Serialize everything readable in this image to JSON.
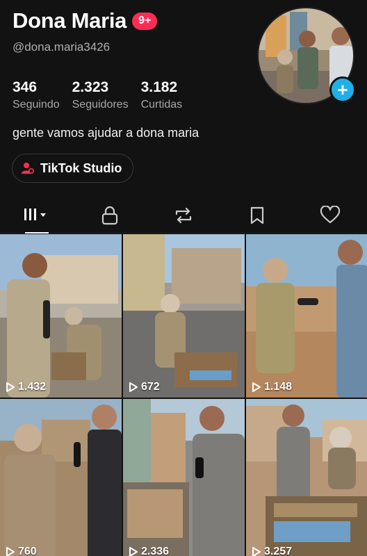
{
  "profile": {
    "name": "Dona Maria",
    "notif_badge": "9+",
    "handle": "@dona.maria3426",
    "bio": "gente vamos ajudar a dona maria"
  },
  "stats": [
    {
      "value": "346",
      "label": "Seguindo"
    },
    {
      "value": "2.323",
      "label": "Seguidores"
    },
    {
      "value": "3.182",
      "label": "Curtidas"
    }
  ],
  "studio_button": {
    "label": "TikTok Studio"
  },
  "tabs": [
    {
      "icon": "grid-icon",
      "active": true
    },
    {
      "icon": "lock-icon",
      "active": false
    },
    {
      "icon": "repost-icon",
      "active": false
    },
    {
      "icon": "bookmark-icon",
      "active": false
    },
    {
      "icon": "heart-icon",
      "active": false
    }
  ],
  "videos": [
    {
      "views": "1.432"
    },
    {
      "views": "672"
    },
    {
      "views": "1.148"
    },
    {
      "views": "760"
    },
    {
      "views": "2.336"
    },
    {
      "views": "3.257"
    }
  ],
  "colors": {
    "accent": "#fe2c55",
    "add_button": "#20b0e8",
    "background": "#121212"
  }
}
